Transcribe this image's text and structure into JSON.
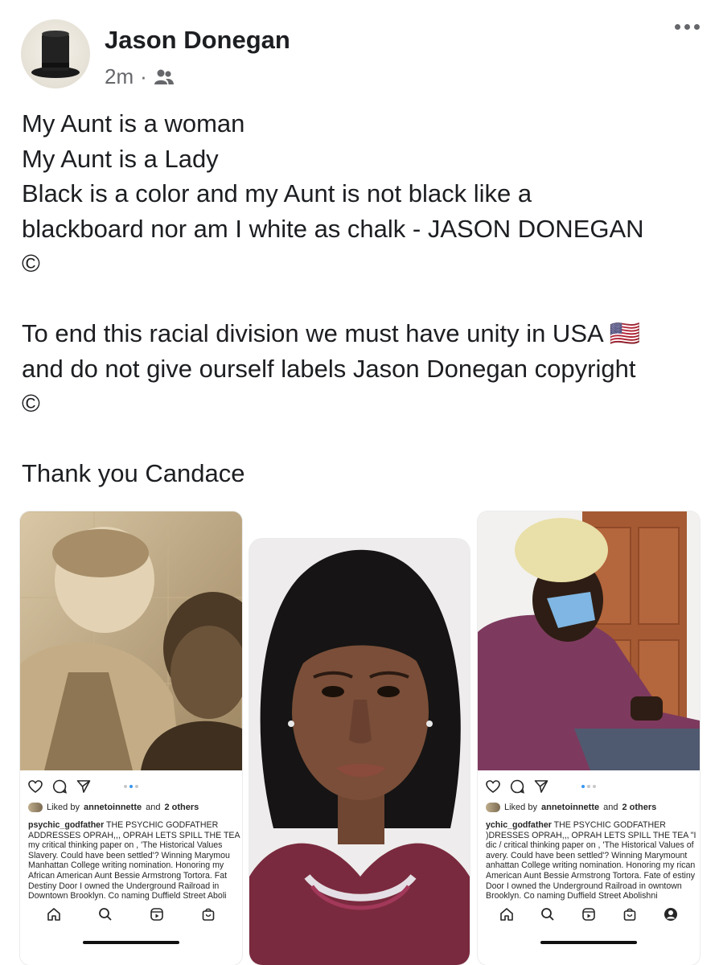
{
  "post": {
    "author": "Jason Donegan",
    "time": "2m",
    "separator": "·",
    "audience_icon": "friends-icon",
    "more_icon": "more-options-icon",
    "lines": [
      "My Aunt is a woman",
      "My Aunt is a Lady",
      "Black is a color and my Aunt is not black like a",
      "blackboard nor am I white as chalk - JASON DONEGAN",
      "©",
      "",
      "To end this racial division we must have unity in USA 🇺🇸",
      "and do not give ourself labels Jason Donegan copyright",
      "©",
      "",
      "Thank you Candace"
    ]
  },
  "instagram_left": {
    "liked_prefix": "Liked by",
    "liked_user": "annetoinnette",
    "liked_suffix": "and",
    "liked_others": "2 others",
    "caption_user": "psychic_godfather",
    "caption_text": "THE PSYCHIC GODFATHER ADDRESSES OPRAH,,, OPRAH LETS SPILL THE TEA my critical thinking paper on , 'The Historical Values Slavery. Could have been settled'? Winning Marymou Manhattan College writing nomination. Honoring my African American Aunt Bessie Armstrong Tortora. Fat Destiny Door I owned the Underground Railroad in Downtown Brooklyn. Co naming Duffield Street Aboli"
  },
  "instagram_right": {
    "liked_prefix": "Liked by",
    "liked_user": "annetoinnette",
    "liked_suffix": "and",
    "liked_others": "2 others",
    "caption_user": "ychic_godfather",
    "caption_text": "THE PSYCHIC GODFATHER )DRESSES OPRAH,,, OPRAH LETS SPILL THE TEA \"I dic / critical thinking paper on , 'The Historical Values of avery. Could have been settled'? Winning Marymount anhattan College writing nomination. Honoring my rican American Aunt Bessie Armstrong Tortora. Fate of estiny Door I owned the Underground Railroad in owntown Brooklyn. Co naming Duffield Street Abolishni"
  },
  "colors": {
    "text": "#1c1e21",
    "secondary": "#65676b",
    "ig_blue": "#3897f0"
  }
}
